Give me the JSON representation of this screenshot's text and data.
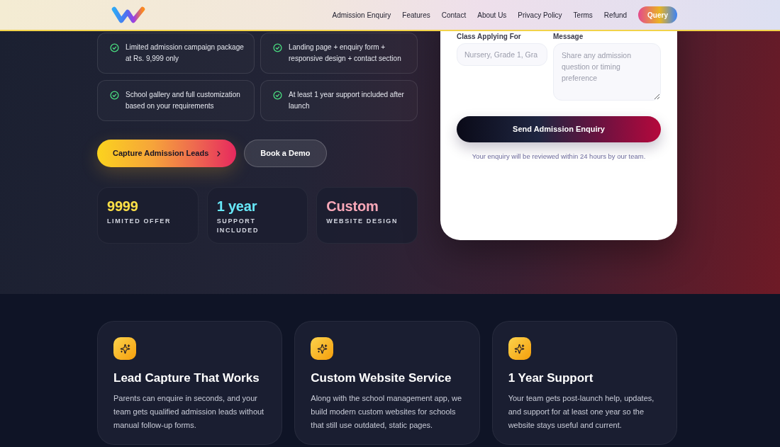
{
  "navbar": {
    "links": [
      "Admission Enquiry",
      "Features",
      "Contact",
      "About Us",
      "Privacy Policy",
      "Terms",
      "Refund"
    ],
    "query_button": "Query"
  },
  "hero": {
    "highlights": [
      "Limited admission campaign package at Rs. 9,999 only",
      "Landing page + enquiry form + responsive design + contact section",
      "School gallery and full customization based on your requirements",
      "At least 1 year support included after launch"
    ],
    "buttons": [
      {
        "kind": "primary",
        "label": "Capture Admission Leads"
      },
      {
        "kind": "secondary",
        "label": "Book a Demo"
      }
    ],
    "stats": [
      {
        "value": "9999",
        "label": "LIMITED OFFER",
        "color": "#fde047"
      },
      {
        "value": "1 year",
        "label": "SUPPORT INCLUDED",
        "color": "#67e8f9"
      },
      {
        "value": "Custom",
        "label": "WEBSITE DESIGN",
        "color": "#f9a8b8"
      }
    ]
  },
  "enquiry_form": {
    "fields": [
      {
        "kind": "input",
        "label": "Class Applying For",
        "placeholder": "Nursery, Grade 1, Gra"
      },
      {
        "kind": "textarea",
        "label": "Message",
        "placeholder": "Share any admission question or timing preference"
      }
    ],
    "submit": "Send Admission Enquiry",
    "note": "Your enquiry will be reviewed within 24 hours by our team."
  },
  "features": [
    {
      "title": "Lead Capture That Works",
      "description": "Parents can enquire in seconds, and your team gets qualified admission leads without manual follow-up forms."
    },
    {
      "title": "Custom Website Service",
      "description": "Along with the school management app, we build modern custom websites for schools that still use outdated, static pages."
    },
    {
      "title": "1 Year Support",
      "description": "Your team gets post-launch help, updates, and support for at least one year so the website stays useful and current."
    }
  ]
}
